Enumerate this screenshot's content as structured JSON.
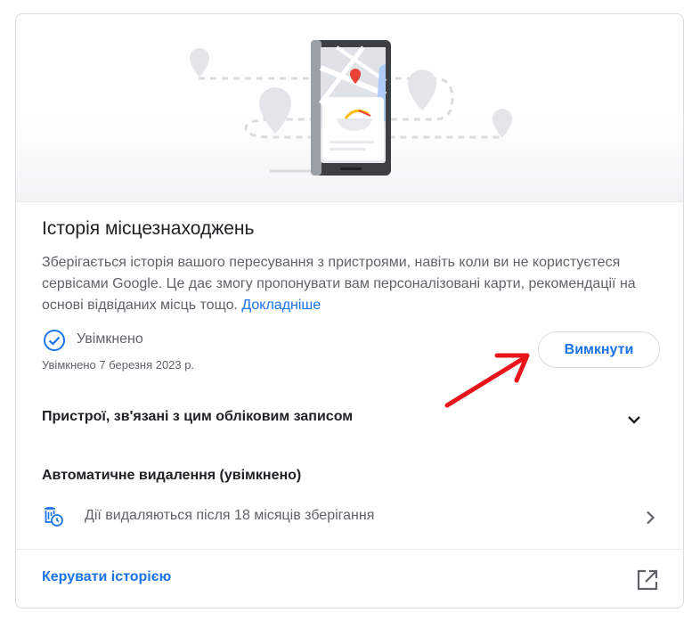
{
  "card": {
    "title": "Історія місцезнаходжень",
    "description": "Зберігається історія вашого пересування з пристроями, навіть коли ви не користуєтеся сервісами Google. Це дає змогу пропонувати вам персоналізовані карти, рекомендації на основі відвіданих місць тощо.",
    "learn_more": "Докладніше",
    "status_label": "Увімкнено",
    "status_date": "Увімкнено 7 березня 2023 р.",
    "turn_off_button": "Вимкнути"
  },
  "devices_row": {
    "label": "Пристрої, зв'язані з цим обліковим записом",
    "icon": "chevron-down-icon"
  },
  "auto_delete": {
    "title": "Автоматичне видалення (увімкнено)",
    "text": "Дії видаляються після 18 місяців зберігання",
    "icon": "auto-delete-icon"
  },
  "manage": {
    "label": "Керувати історією",
    "icon": "open-in-new-icon"
  },
  "colors": {
    "accent": "#1a73e8",
    "arrow": "#e8141a",
    "pin": "#ea4335"
  }
}
